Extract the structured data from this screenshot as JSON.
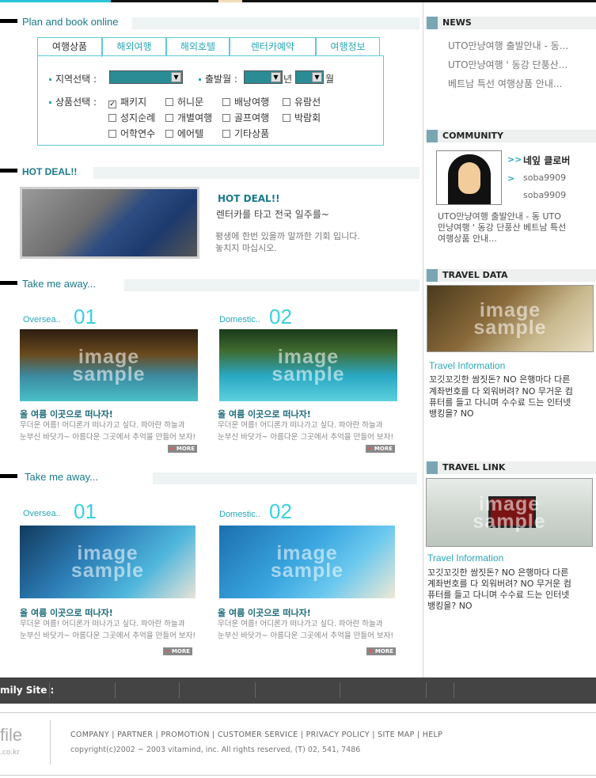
{
  "plan": {
    "title": "Plan and book online",
    "tabs": [
      "여행상품",
      "해외여행",
      "해외호텔",
      "렌터카예약",
      "여행정보"
    ],
    "region_label": "지역선택 :",
    "depart_label": "출발월 :",
    "year_suffix": "년",
    "month_suffix": "월",
    "product_label": "상품선택 :",
    "checkbox_checked_mark": "✓",
    "products": [
      {
        "label": "패키지",
        "checked": true
      },
      {
        "label": "허니문",
        "checked": false
      },
      {
        "label": "배낭여행",
        "checked": false
      },
      {
        "label": "유람선",
        "checked": false
      },
      {
        "label": "성지순례",
        "checked": false
      },
      {
        "label": "개별여행",
        "checked": false
      },
      {
        "label": "골프여행",
        "checked": false
      },
      {
        "label": "박람회",
        "checked": false
      },
      {
        "label": "어학연수",
        "checked": false
      },
      {
        "label": "에어텔",
        "checked": false
      },
      {
        "label": "기타상품",
        "checked": false
      }
    ]
  },
  "hotdeal": {
    "title": "HOT DEAL!!",
    "deal_title": "HOT DEAL!!",
    "deal_sub": "렌터카를 타고 전국 일주를~",
    "deal_desc1": "평생에 한번 있을까 말까한 기회 입니다.",
    "deal_desc2": "놓치지 마십시오."
  },
  "image_watermark": [
    "image",
    "sample"
  ],
  "take1": {
    "title": "Take me away...",
    "cards": [
      {
        "cat": "Oversea..",
        "num": "01",
        "title": "올 여름 이곳으로 떠나자!",
        "desc1": "무더운 여름! 어디론가 떠나가고 싶다. 파아란 하늘과",
        "desc2": "눈부신 바닷가~ 아름다운 그곳에서 추억을 만들어 보자!",
        "more": "MORE"
      },
      {
        "cat": "Domestic..",
        "num": "02",
        "title": "올 여름 이곳으로 떠나자!",
        "desc1": "무더운 여름! 어디론가 떠나가고 싶다. 파아란 하늘과",
        "desc2": "눈부신 바닷가~ 아름다운 그곳에서 추억을 만들어 보자!",
        "more": "MORE"
      }
    ]
  },
  "take2": {
    "title": "Take me away...",
    "cards": [
      {
        "cat": "Oversea..",
        "num": "01",
        "title": "올 여름 이곳으로 떠나자!",
        "desc1": "무더운 여름! 어디론가 떠나가고 싶다. 파아란 하늘과",
        "desc2": "눈부신 바닷가~ 아름다운 그곳에서 추억을 만들어 보자!",
        "more": "MORE"
      },
      {
        "cat": "Domestic..",
        "num": "02",
        "title": "올 여름 이곳으로 떠나자!",
        "desc1": "무더운 여름! 어디론가 떠나가고 싶다. 파아란 하늘과",
        "desc2": "눈부신 바닷가~ 아름다운 그곳에서 추억을 만들어 보자!",
        "more": "MORE"
      }
    ]
  },
  "news": {
    "title": "NEWS",
    "items": [
      "UTO만냥여행 출발안내 - 동...",
      "UTO만냥여행 ' 동강 단풍산...",
      "베트남 특선 여행상품 안내..."
    ]
  },
  "community": {
    "title": "COMMUNITY",
    "club_arrow": ">>",
    "club_name": "네잎 클로버",
    "arrow": ">",
    "user1": "soba9909",
    "user2": "soba9909",
    "text1": "UTO만냥여행 출발안내 - 동 UTO",
    "text2": "만냥여행 ' 동강 단풍산 베트남 특선",
    "text3": "여행상품 안내..."
  },
  "travel_data": {
    "title": "TRAVEL DATA",
    "label": "Travel Information",
    "text1": "꼬깃꼬깃한 쌈짓돈? NO 은행마다 다른",
    "text2": "계좌번호를 다 외워버려? NO 무거운 컴",
    "text3": "퓨터를 들고 다니며 수수료 드는 인터넷",
    "text4": "뱅킹을? NO"
  },
  "travel_link": {
    "title": "TRAVEL LINK",
    "label": "Travel Information",
    "text1": "꼬깃꼬깃한 쌈짓돈? NO 은행마다 다른",
    "text2": "계좌번호를 다 외워버려? NO 무거운 컴",
    "text3": "퓨터를 들고 다니며 수수료 드는 인터넷",
    "text4": "뱅킹을? NO"
  },
  "footer": {
    "family_site": "mily Site :",
    "logo": "file",
    "logo_sub": ".co.kr",
    "links": "COMPANY | PARTNER | PROMOTION | CUSTOMER SERVICE | PRIVACY POLICY | SITE MAP | HELP",
    "copyright": "copyright(c)2002 ~ 2003 vitamind, inc.   All rights reserved, (T) 02, 541, 7486"
  },
  "colors": {
    "accent": "#2aa7b7",
    "title": "#1a7a8a",
    "bar": "#444444"
  }
}
